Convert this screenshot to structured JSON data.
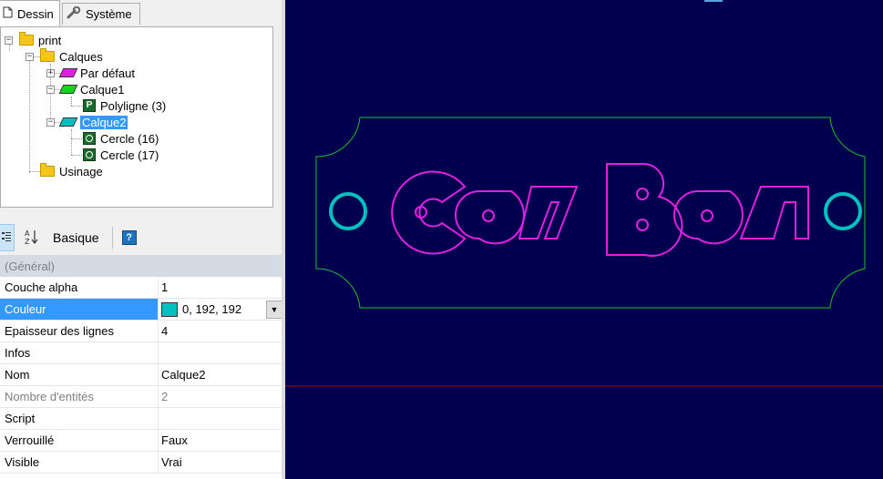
{
  "tabs": [
    {
      "label": "Dessin",
      "icon": "page-icon",
      "active": true
    },
    {
      "label": "Système",
      "icon": "wrench-icon",
      "active": false
    }
  ],
  "tree": {
    "root": "print",
    "layers_folder": "Calques",
    "layers": [
      {
        "label": "Par défaut",
        "color": "#e020e0",
        "children": []
      },
      {
        "label": "Calque1",
        "color": "#20d020",
        "children": [
          "Polyligne (3)"
        ]
      },
      {
        "label": "Calque2",
        "color": "#00c0c0",
        "selected": true,
        "children": [
          "Cercle (16)",
          "Cercle (17)"
        ]
      }
    ],
    "machining_folder": "Usinage"
  },
  "toolbar": {
    "categorized_icon": "categorized-icon",
    "alpha_icon": "sort-az-icon",
    "basique": "Basique",
    "help_icon": "help-icon"
  },
  "grid": {
    "category": "(Général)",
    "rows": [
      {
        "name": "Couche alpha",
        "value": "1"
      },
      {
        "name": "Couleur",
        "value": "0, 192, 192",
        "swatch": "#00c0c0",
        "selected": true,
        "dropdown": true
      },
      {
        "name": "Epaisseur des lignes",
        "value": "4"
      },
      {
        "name": "Infos",
        "value": ""
      },
      {
        "name": "Nom",
        "value": "Calque2"
      },
      {
        "name": "Nombre d'entités",
        "value": "2",
        "disabled": true
      },
      {
        "name": "Script",
        "value": ""
      },
      {
        "name": "Verrouillé",
        "value": "Faux"
      },
      {
        "name": "Visible",
        "value": "Vrai"
      }
    ]
  },
  "canvas": {
    "background": "#00004f",
    "outline_color": "#20c020",
    "text_color": "#e020e0",
    "circle_color": "#00c0c0",
    "axis_color": "#a01010",
    "logo_text": "CamBam"
  }
}
